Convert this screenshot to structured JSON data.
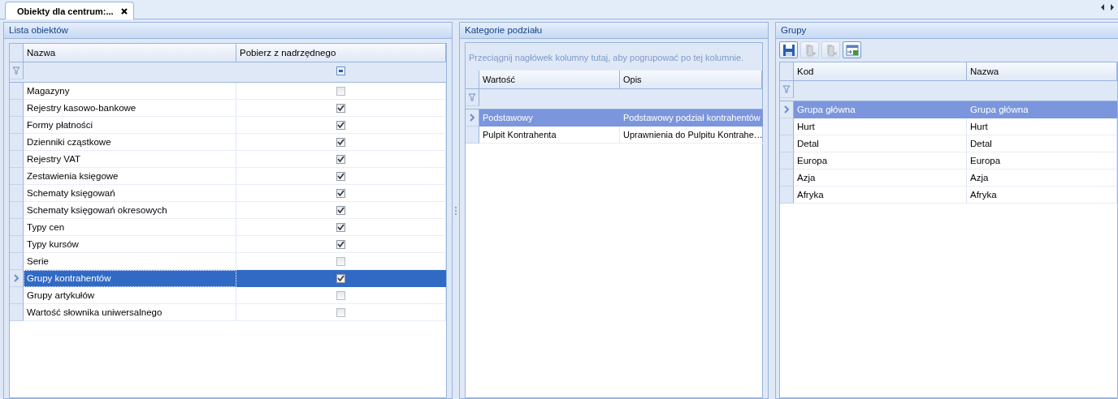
{
  "document_tab": {
    "title": "Obiekty dla centrum:...",
    "selected": true
  },
  "panels": [
    {
      "title": "Lista obiektów",
      "focused": true,
      "columns": [
        "Nazwa",
        "Pobierz z nadrzędnego"
      ],
      "rows": [
        {
          "name": "Magazyny",
          "checked": false,
          "selected": false
        },
        {
          "name": "Rejestry kasowo-bankowe",
          "checked": true,
          "selected": false
        },
        {
          "name": "Formy płatności",
          "checked": true,
          "selected": false
        },
        {
          "name": "Dzienniki cząstkowe",
          "checked": true,
          "selected": false
        },
        {
          "name": "Rejestry VAT",
          "checked": true,
          "selected": false
        },
        {
          "name": "Zestawienia księgowe",
          "checked": true,
          "selected": false
        },
        {
          "name": "Schematy księgowań",
          "checked": true,
          "selected": false
        },
        {
          "name": "Schematy księgowań okresowych",
          "checked": true,
          "selected": false
        },
        {
          "name": "Typy cen",
          "checked": true,
          "selected": false
        },
        {
          "name": "Typy kursów",
          "checked": true,
          "selected": false
        },
        {
          "name": "Serie",
          "checked": false,
          "selected": false
        },
        {
          "name": "Grupy kontrahentów",
          "checked": true,
          "selected": true
        },
        {
          "name": "Grupy artykułów",
          "checked": false,
          "selected": false
        },
        {
          "name": "Wartość słownika uniwersalnego",
          "checked": false,
          "selected": false
        }
      ]
    },
    {
      "title": "Kategorie podziału",
      "focused": false,
      "group_hint": "Przeciągnij nagłówek kolumny tutaj, aby pogrupować po tej kolumnie.",
      "columns": [
        "Wartość",
        "Opis"
      ],
      "rows": [
        {
          "cells": [
            "Podstawowy",
            "Podstawowy podział kontrahentów"
          ],
          "selected": true
        },
        {
          "cells": [
            "Pulpit Kontrahenta",
            "Uprawnienia do Pulpitu Kontrahe…"
          ],
          "selected": false
        }
      ]
    },
    {
      "title": "Grupy",
      "focused": false,
      "toolbar": [
        {
          "kind": "save",
          "disabled": false
        },
        {
          "kind": "add",
          "disabled": true
        },
        {
          "kind": "delete",
          "disabled": true
        },
        {
          "kind": "export",
          "disabled": false
        }
      ],
      "columns": [
        "Kod",
        "Nazwa"
      ],
      "rows": [
        {
          "cells": [
            "Grupa główna",
            "Grupa główna"
          ],
          "selected": true
        },
        {
          "cells": [
            "Hurt",
            "Hurt"
          ],
          "selected": false
        },
        {
          "cells": [
            "Detal",
            "Detal"
          ],
          "selected": false
        },
        {
          "cells": [
            "Europa",
            "Europa"
          ],
          "selected": false
        },
        {
          "cells": [
            "Azja",
            "Azja"
          ],
          "selected": false
        },
        {
          "cells": [
            "Afryka",
            "Afryka"
          ],
          "selected": false
        }
      ]
    }
  ]
}
